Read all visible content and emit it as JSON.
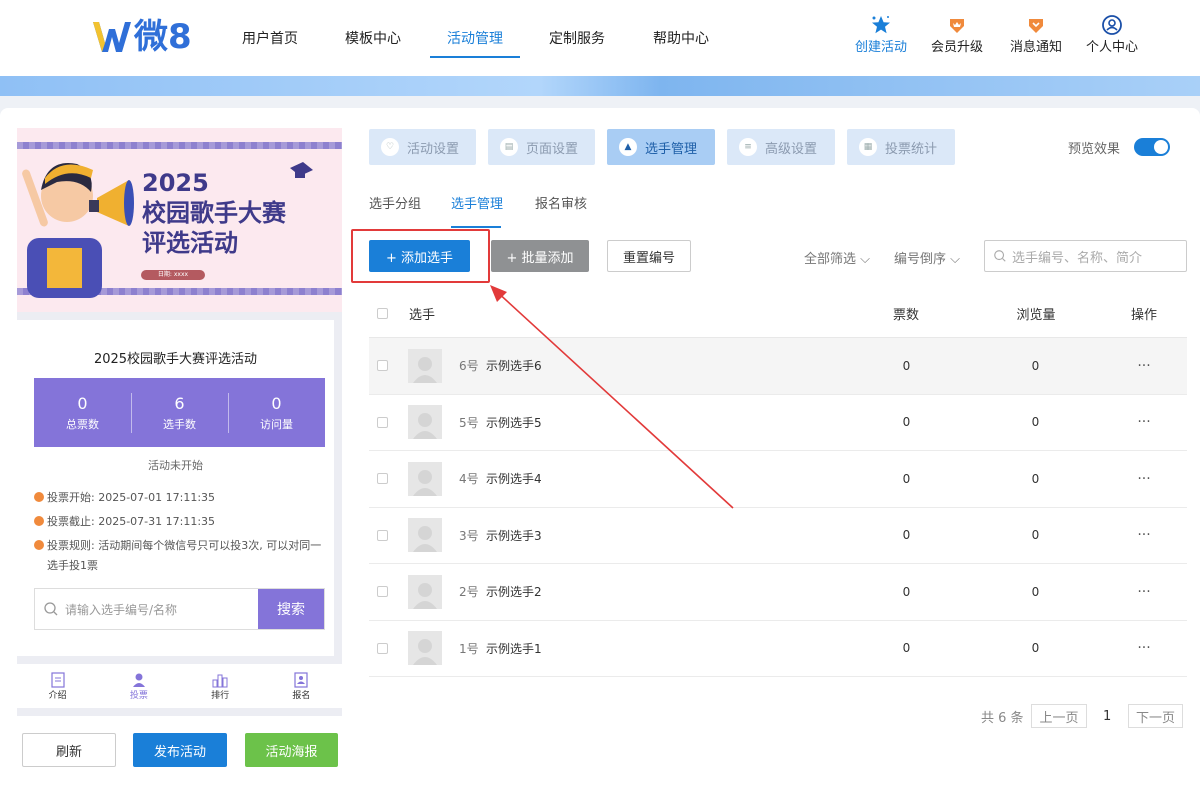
{
  "brand": {
    "logo_text": "微8"
  },
  "nav": [
    {
      "label": "用户首页"
    },
    {
      "label": "模板中心"
    },
    {
      "label": "活动管理"
    },
    {
      "label": "定制服务"
    },
    {
      "label": "帮助中心"
    }
  ],
  "top_actions": [
    {
      "label": "创建活动",
      "icon": "star-icon"
    },
    {
      "label": "会员升级",
      "icon": "crown-icon"
    },
    {
      "label": "消息通知",
      "icon": "bell-icon"
    },
    {
      "label": "个人中心",
      "icon": "user-icon"
    }
  ],
  "preview": {
    "banner_year": "2025",
    "banner_line1": "校园歌手大赛",
    "banner_line2": "评选活动",
    "banner_date": "日期: xxxx",
    "title": "2025校园歌手大赛评选活动",
    "stats": [
      {
        "value": "0",
        "label": "总票数"
      },
      {
        "value": "6",
        "label": "选手数"
      },
      {
        "value": "0",
        "label": "访问量"
      }
    ],
    "status": "活动未开始",
    "vote_start": "投票开始: 2025-07-01 17:11:35",
    "vote_end": "投票截止: 2025-07-31 17:11:35",
    "vote_rule": "投票规则: 活动期间每个微信号只可以投3次, 可以对同一选手投1票",
    "search_placeholder": "请输入选手编号/名称",
    "search_button": "搜索",
    "tabs": [
      {
        "label": "介绍"
      },
      {
        "label": "投票"
      },
      {
        "label": "排行"
      },
      {
        "label": "报名"
      }
    ]
  },
  "bottom_buttons": {
    "refresh": "刷新",
    "publish": "发布活动",
    "poster": "活动海报"
  },
  "steps": [
    {
      "label": "活动设置"
    },
    {
      "label": "页面设置"
    },
    {
      "label": "选手管理"
    },
    {
      "label": "高级设置"
    },
    {
      "label": "投票统计"
    }
  ],
  "preview_toggle": {
    "label": "预览效果",
    "on": true
  },
  "subtabs": [
    {
      "label": "选手分组"
    },
    {
      "label": "选手管理"
    },
    {
      "label": "报名审核"
    }
  ],
  "toolbar": {
    "add": "+ 添加选手",
    "batch_add": "+ 批量添加",
    "reset_number": "重置编号",
    "filter_all": "全部筛选",
    "sort": "编号倒序",
    "search_placeholder": "选手编号、名称、简介"
  },
  "table": {
    "headers": {
      "player": "选手",
      "votes": "票数",
      "views": "浏览量",
      "ops": "操作"
    },
    "rows": [
      {
        "number": "6号",
        "name": "示例选手6",
        "votes": "0",
        "views": "0"
      },
      {
        "number": "5号",
        "name": "示例选手5",
        "votes": "0",
        "views": "0"
      },
      {
        "number": "4号",
        "name": "示例选手4",
        "votes": "0",
        "views": "0"
      },
      {
        "number": "3号",
        "name": "示例选手3",
        "votes": "0",
        "views": "0"
      },
      {
        "number": "2号",
        "name": "示例选手2",
        "votes": "0",
        "views": "0"
      },
      {
        "number": "1号",
        "name": "示例选手1",
        "votes": "0",
        "views": "0"
      }
    ]
  },
  "pagination": {
    "total": "共 6 条",
    "prev": "上一页",
    "current": "1",
    "next": "下一页"
  },
  "colors": {
    "accent": "#1a7fd8",
    "purple": "#8474d9",
    "highlight": "#e23a3a",
    "green": "#6cc24a"
  }
}
